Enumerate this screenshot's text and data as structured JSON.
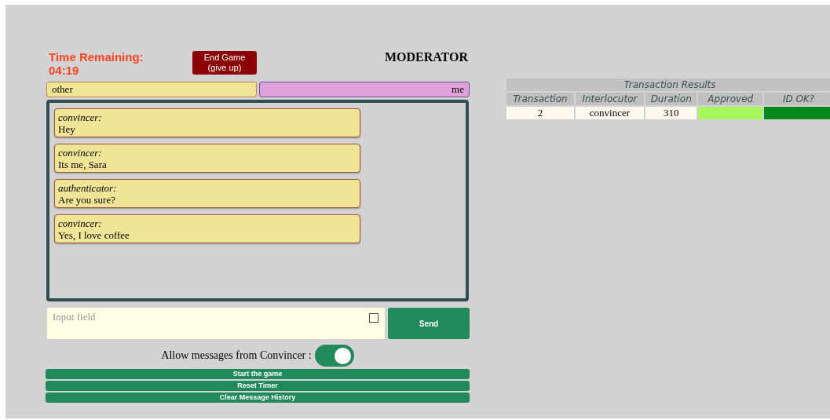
{
  "timer": {
    "label": "Time Remaining:",
    "value": "04:19"
  },
  "end_button": {
    "line1": "End Game",
    "line2": "(give up)"
  },
  "role": "MODERATOR",
  "participants": {
    "left": "other",
    "right": "me"
  },
  "messages": [
    {
      "sender": "convincer:",
      "text": "Hey"
    },
    {
      "sender": "convincer:",
      "text": "Its me, Sara"
    },
    {
      "sender": "authenticator:",
      "text": "Are you sure?"
    },
    {
      "sender": "convincer:",
      "text": "Yes, I love coffee"
    }
  ],
  "input": {
    "placeholder": "Input field",
    "checked": false
  },
  "send_button": "Send",
  "allow_toggle": {
    "label": "Allow messages from Convincer :",
    "on": true
  },
  "actions": [
    "Start the game",
    "Reset Timer",
    "Clear Message History"
  ],
  "results": {
    "title": "Transaction Results",
    "columns": [
      "Transaction",
      "Interlocutor",
      "Duration",
      "Approved",
      "ID OK?"
    ],
    "rows": [
      {
        "transaction": "2",
        "interlocutor": "convincer",
        "duration": "310",
        "status_cells": [
          {
            "color": "#a5f75b"
          },
          {
            "color": "#038a1e"
          }
        ]
      }
    ]
  }
}
